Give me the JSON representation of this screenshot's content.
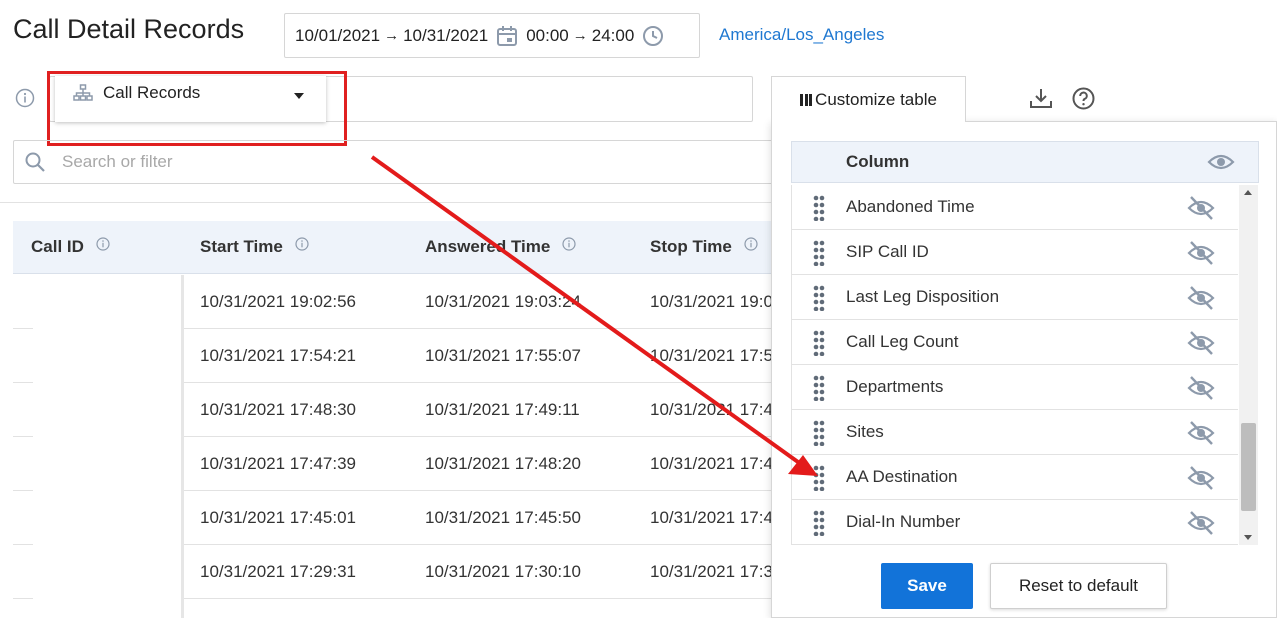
{
  "page": {
    "title": "Call Detail Records",
    "date_range": {
      "start_date": "10/01/2021",
      "end_date": "10/31/2021",
      "arrow": "→",
      "start_time": "00:00",
      "end_time": "24:00"
    },
    "timezone": "America/Los_Angeles"
  },
  "record_selector": {
    "label": "Call Records"
  },
  "search": {
    "placeholder": "Search or filter"
  },
  "table": {
    "columns": [
      "Call ID",
      "Start Time",
      "Answered Time",
      "Stop Time"
    ],
    "rows": [
      {
        "start": "10/31/2021 19:02:56",
        "answered": "10/31/2021 19:03:24",
        "stop": "10/31/2021 19:0"
      },
      {
        "start": "10/31/2021 17:54:21",
        "answered": "10/31/2021 17:55:07",
        "stop": "10/31/2021 17:5"
      },
      {
        "start": "10/31/2021 17:48:30",
        "answered": "10/31/2021 17:49:11",
        "stop": "10/31/2021 17:4"
      },
      {
        "start": "10/31/2021 17:47:39",
        "answered": "10/31/2021 17:48:20",
        "stop": "10/31/2021 17:4"
      },
      {
        "start": "10/31/2021 17:45:01",
        "answered": "10/31/2021 17:45:50",
        "stop": "10/31/2021 17:4"
      },
      {
        "start": "10/31/2021 17:29:31",
        "answered": "10/31/2021 17:30:10",
        "stop": "10/31/2021 17:3"
      }
    ]
  },
  "toolbar": {
    "customize_label": "Customize table"
  },
  "customize_panel": {
    "header": "Column",
    "items": [
      "Abandoned Time",
      "SIP Call ID",
      "Last Leg Disposition",
      "Call Leg Count",
      "Departments",
      "Sites",
      "AA Destination",
      "Dial-In Number"
    ],
    "scroll_position": 0.92,
    "save_label": "Save",
    "reset_label": "Reset to default"
  },
  "colors": {
    "accent": "#1273d9",
    "link": "#1f78d1",
    "annotation": "#e02020",
    "header_bg": "#eef3fa"
  }
}
